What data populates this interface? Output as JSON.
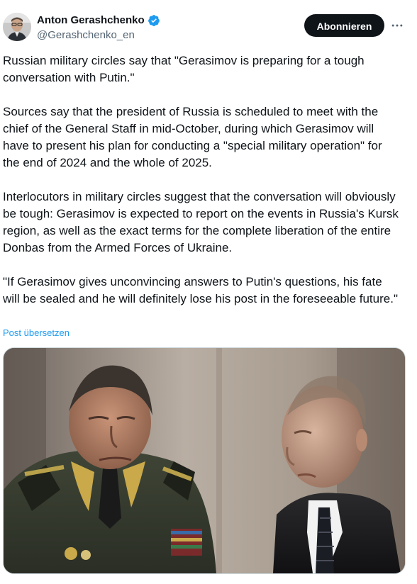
{
  "author": {
    "display_name": "Anton Gerashchenko",
    "handle": "@Gerashchenko_en",
    "verified_icon": "verified-badge-icon",
    "avatar_icon": "avatar"
  },
  "actions": {
    "follow_label": "Abonnieren",
    "more_icon": "more-options-icon"
  },
  "tweet": {
    "paragraphs": [
      "Russian military circles say that \"Gerasimov is preparing for a tough conversation with Putin.\"",
      "Sources say that the president of Russia is scheduled to meet with the chief of the General Staff in mid-October, during which Gerasimov will have to present his plan for conducting a \"special military operation\" for the end of 2024 and the whole of 2025.",
      "Interlocutors in military circles suggest that the conversation will obviously be tough: Gerasimov is expected to report on the events in Russia's Kursk region, as well as the exact terms for the complete liberation of the entire Donbas from the Armed Forces of Ukraine.",
      "\"If Gerasimov gives unconvincing answers to Putin's questions, his fate will be sealed and he will definitely lose his post in the foreseeable future.\""
    ],
    "translate_label": "Post übersetzen"
  },
  "colors": {
    "text": "#0f1419",
    "secondary": "#536471",
    "link": "#1d9bf0",
    "button_bg": "#0f1419",
    "button_text": "#ffffff"
  }
}
